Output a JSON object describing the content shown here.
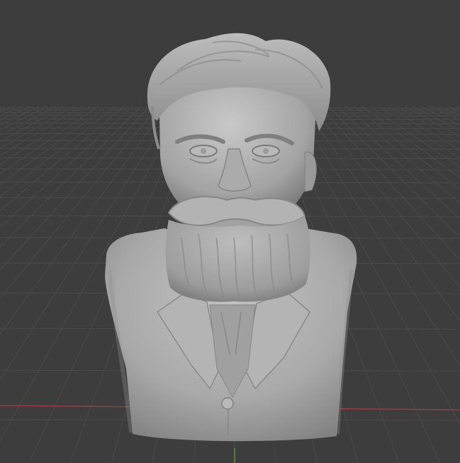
{
  "viewport": {
    "background_color": "#3d3d3d",
    "grid_line_color": "#4a4a4a",
    "x_axis_color": "#a33c47",
    "y_axis_color": "#6d9a2a"
  },
  "model": {
    "kind": "sculpted-bust",
    "subject": "bearded-man-in-waistcoat",
    "material_color": "#a6a6a6",
    "shadow_color": "#6f6f6f",
    "highlight_color": "#cfcfcf"
  }
}
